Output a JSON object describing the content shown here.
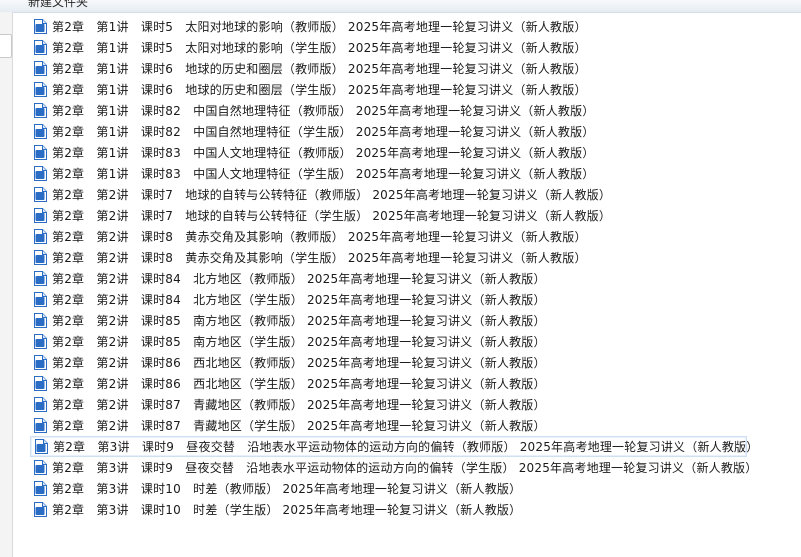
{
  "header": {
    "title": "新建文件夹"
  },
  "files": [
    "第2章　第1讲　课时5　太阳对地球的影响（教师版）  2025年高考地理一轮复习讲义（新人教版）",
    "第2章　第1讲　课时5　太阳对地球的影响（学生版）  2025年高考地理一轮复习讲义（新人教版）",
    "第2章　第1讲　课时6　地球的历史和圈层（教师版）  2025年高考地理一轮复习讲义（新人教版）",
    "第2章　第1讲　课时6　地球的历史和圈层（学生版）  2025年高考地理一轮复习讲义（新人教版）",
    "第2章　第1讲　课时82　中国自然地理特征（教师版）  2025年高考地理一轮复习讲义（新人教版）",
    "第2章　第1讲　课时82　中国自然地理特征（学生版）  2025年高考地理一轮复习讲义（新人教版）",
    "第2章　第1讲　课时83　中国人文地理特征（教师版）  2025年高考地理一轮复习讲义（新人教版）",
    "第2章　第1讲　课时83　中国人文地理特征（学生版）  2025年高考地理一轮复习讲义（新人教版）",
    "第2章　第2讲　课时7　地球的自转与公转特征（教师版）  2025年高考地理一轮复习讲义（新人教版）",
    "第2章　第2讲　课时7　地球的自转与公转特征（学生版）  2025年高考地理一轮复习讲义（新人教版）",
    "第2章　第2讲　课时8　黄赤交角及其影响（教师版）  2025年高考地理一轮复习讲义（新人教版）",
    "第2章　第2讲　课时8　黄赤交角及其影响（学生版）  2025年高考地理一轮复习讲义（新人教版）",
    "第2章　第2讲　课时84　北方地区（教师版）  2025年高考地理一轮复习讲义（新人教版）",
    "第2章　第2讲　课时84　北方地区（学生版）  2025年高考地理一轮复习讲义（新人教版）",
    "第2章　第2讲　课时85　南方地区（教师版）  2025年高考地理一轮复习讲义（新人教版）",
    "第2章　第2讲　课时85　南方地区（学生版）  2025年高考地理一轮复习讲义（新人教版）",
    "第2章　第2讲　课时86　西北地区（教师版）  2025年高考地理一轮复习讲义（新人教版）",
    "第2章　第2讲　课时86　西北地区（学生版）  2025年高考地理一轮复习讲义（新人教版）",
    "第2章　第2讲　课时87　青藏地区（教师版）  2025年高考地理一轮复习讲义（新人教版）",
    "第2章　第2讲　课时87　青藏地区（学生版）  2025年高考地理一轮复习讲义（新人教版）",
    "第2章　第3讲　课时9　昼夜交替　沿地表水平运动物体的运动方向的偏转（教师版）  2025年高考地理一轮复习讲义（新人教版）",
    "第2章　第3讲　课时9　昼夜交替　沿地表水平运动物体的运动方向的偏转（学生版）  2025年高考地理一轮复习讲义（新人教版）",
    "第2章　第3讲　课时10　时差（教师版）  2025年高考地理一轮复习讲义（新人教版）",
    "第2章　第3讲　课时10　时差（学生版）  2025年高考地理一轮复习讲义（新人教版）"
  ],
  "hovered_index": 20,
  "icon": {
    "name": "word-doc-icon",
    "color": "#2b6cc4",
    "letter": "W"
  }
}
